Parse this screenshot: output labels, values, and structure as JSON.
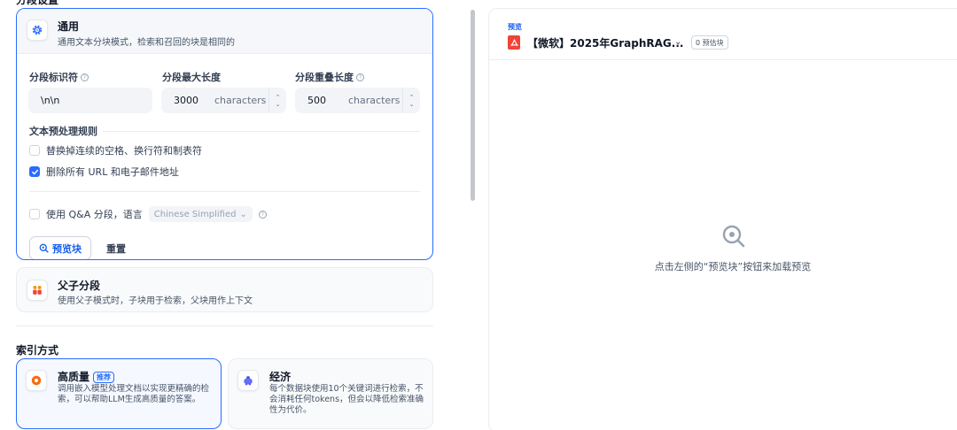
{
  "segment_settings": {
    "title": "分段设置",
    "general": {
      "title": "通用",
      "description": "通用文本分块模式，检索和召回的块是相同的",
      "separator": {
        "label": "分段标识符",
        "value": "\\n\\n"
      },
      "max_length": {
        "label": "分段最大长度",
        "value": "3000",
        "unit": "characters"
      },
      "overlap": {
        "label": "分段重叠长度",
        "value": "500",
        "unit": "characters"
      },
      "rules": {
        "title": "文本预处理规则",
        "items": [
          {
            "label": "替换掉连续的空格、换行符和制表符",
            "checked": false
          },
          {
            "label": "删除所有 URL 和电子邮件地址",
            "checked": true
          }
        ]
      },
      "qa": {
        "label": "使用 Q&A 分段，语言",
        "checked": false,
        "language": "Chinese Simplified"
      },
      "buttons": {
        "preview": "预览块",
        "reset": "重置"
      }
    },
    "parent_child": {
      "title": "父子分段",
      "description": "使用父子模式时，子块用于检索，父块用作上下文"
    }
  },
  "index_method": {
    "title": "索引方式",
    "high_quality": {
      "title": "高质量",
      "badge": "推荐",
      "description": "调用嵌入模型处理文档以实现更精确的检索，可以帮助LLM生成高质量的答案。"
    },
    "economy": {
      "title": "经济",
      "description": "每个数据块使用10个关键词进行检索，不会消耗任何tokens，但会以降低检索准确性为代价。"
    }
  },
  "preview": {
    "label": "预览",
    "document": "【微软】2025年GraphRAG...",
    "estimate_badge": "0 预估块",
    "empty_text": "点击左侧的“预览块”按钮来加载预览"
  },
  "colors": {
    "accent": "#296dff",
    "pdf": "#f04438"
  }
}
